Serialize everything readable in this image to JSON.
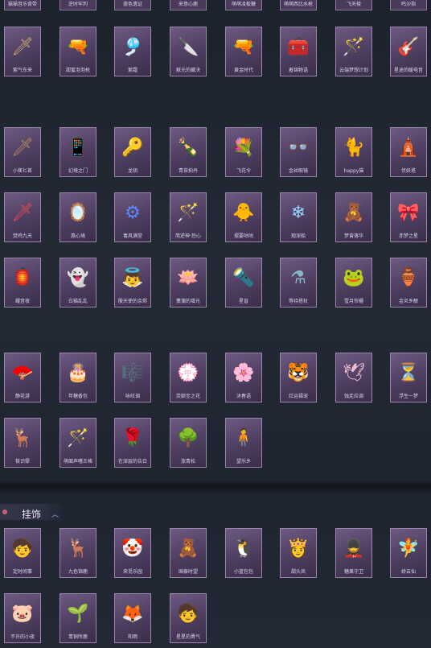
{
  "top_row": [
    "猫猫音乐背带",
    "逆时牢判",
    "鎏色遗证",
    "来意心鹿",
    "萌萌凌板鞭",
    "萌萌西比水枪",
    "飞天棱",
    "鸣沙指"
  ],
  "grid_a": [
    [
      {
        "label": "紫气东来",
        "icon": "sword-icon",
        "glyph": "🗡",
        "color": "#c7a46a"
      },
      {
        "label": "甜蜜泡泡枪",
        "icon": "bubble-gun-icon",
        "glyph": "🔫",
        "color": "#f2a8d0"
      },
      {
        "label": "絮霜",
        "icon": "flute-icon",
        "glyph": "🎐",
        "color": "#e6e6e6"
      },
      {
        "label": "献光的藏决",
        "icon": "blade-icon",
        "glyph": "🔪",
        "color": "#8ea3c8"
      },
      {
        "label": "黄金时代",
        "icon": "revolver-icon",
        "glyph": "🔫",
        "color": "#d2a04a"
      },
      {
        "label": "着锦物语",
        "icon": "medkit-icon",
        "glyph": "🧰",
        "color": "#d24a5a"
      },
      {
        "label": "云端梦想计划",
        "icon": "wand-icon",
        "glyph": "🪄",
        "color": "#7ec0ff"
      },
      {
        "label": "星途的暖电音",
        "icon": "guitar-icon",
        "glyph": "🎸",
        "color": "#b48ae6"
      }
    ],
    [
      {
        "label": "小崔匕首",
        "icon": "dagger-icon",
        "glyph": "🗡",
        "color": "#b08a5a"
      },
      {
        "label": "幻境之门",
        "icon": "phone-icon",
        "glyph": "📱",
        "color": "#a0b8ff"
      },
      {
        "label": "龙钥",
        "icon": "key-icon",
        "glyph": "🔑",
        "color": "#e6c45a"
      },
      {
        "label": "青苔拍丹",
        "icon": "bottle-icon",
        "glyph": "🍾",
        "color": "#8fd1a0"
      },
      {
        "label": "飞花令",
        "icon": "bouquet-icon",
        "glyph": "💐",
        "color": "#e66a8a"
      },
      {
        "label": "金丝眼镜",
        "icon": "glasses-icon",
        "glyph": "👓",
        "color": "#c8c8c8"
      },
      {
        "label": "happy猫",
        "icon": "cat-icon",
        "glyph": "🐈",
        "color": "#e6b47a"
      },
      {
        "label": "伏妖塔",
        "icon": "pagoda-icon",
        "glyph": "🛕",
        "color": "#d7c07a"
      }
    ],
    [
      {
        "label": "焚鸡九天",
        "icon": "spear-icon",
        "glyph": "🗡",
        "color": "#e64a4a"
      },
      {
        "label": "惠心境",
        "icon": "mirror-icon",
        "glyph": "🪞",
        "color": "#d8b07a"
      },
      {
        "label": "毒风满堂",
        "icon": "gear-icon",
        "glyph": "⚙",
        "color": "#5a8aff"
      },
      {
        "label": "简逆神·恕心",
        "icon": "scepter-icon",
        "glyph": "🪄",
        "color": "#e65a6a"
      },
      {
        "label": "摆要咕咕",
        "icon": "chick-icon",
        "glyph": "🐥",
        "color": "#f2d24a"
      },
      {
        "label": "观深船",
        "icon": "snowflake-icon",
        "glyph": "❄",
        "color": "#9ad6ff"
      },
      {
        "label": "梦曾落华",
        "icon": "doll-icon",
        "glyph": "🧸",
        "color": "#f0a0b8"
      },
      {
        "label": "赤梦之星",
        "icon": "star-hat-icon",
        "glyph": "🎀",
        "color": "#f49ac8"
      }
    ],
    [
      {
        "label": "耀音夜",
        "icon": "lantern-icon",
        "glyph": "🏮",
        "color": "#d8c07a"
      },
      {
        "label": "白猫乱乱",
        "icon": "ghost-icon",
        "glyph": "👻",
        "color": "#b8d8ff"
      },
      {
        "label": "殷天使的余烬",
        "icon": "angel-doll-icon",
        "glyph": "👼",
        "color": "#f0d0c0"
      },
      {
        "label": "薰蒲的增光",
        "icon": "lotus-icon",
        "glyph": "🪷",
        "color": "#f2a06a"
      },
      {
        "label": "星盲",
        "icon": "rod-icon",
        "glyph": "🔦",
        "color": "#7a8cff"
      },
      {
        "label": "等待搭杖",
        "icon": "cauldron-icon",
        "glyph": "⚗",
        "color": "#8ab8c8"
      },
      {
        "label": "雪月帘櫃",
        "icon": "frog-icon",
        "glyph": "🐸",
        "color": "#8ac07a"
      },
      {
        "label": "金炎乡酿",
        "icon": "jar-icon",
        "glyph": "🏺",
        "color": "#7a9a6a"
      }
    ]
  ],
  "grid_b": [
    [
      {
        "label": "静花游",
        "icon": "fan-icon",
        "glyph": "🪭",
        "color": "#a8e0d0"
      },
      {
        "label": "年糖香包",
        "icon": "cake-icon",
        "glyph": "🎂",
        "color": "#f0b0c8"
      },
      {
        "label": "咏叹调",
        "icon": "harp-icon",
        "glyph": "🎼",
        "color": "#c8b08a"
      },
      {
        "label": "荧娘至之花",
        "icon": "wreath-icon",
        "glyph": "💮",
        "color": "#f2d0e0"
      },
      {
        "label": "沐春语",
        "icon": "branch-icon",
        "glyph": "🌸",
        "color": "#e6e6b0"
      },
      {
        "label": "红运福宠",
        "icon": "cat-toy-icon",
        "glyph": "🐯",
        "color": "#f2c04a"
      },
      {
        "label": "蚀走应调",
        "icon": "bird-icon",
        "glyph": "🕊",
        "color": "#f0c0d0"
      },
      {
        "label": "浮生一梦",
        "icon": "hourglass-icon",
        "glyph": "⏳",
        "color": "#d8c890"
      }
    ],
    [
      {
        "label": "筱识霏",
        "icon": "antler-icon",
        "glyph": "🦌",
        "color": "#d8b07a"
      },
      {
        "label": "萌面声嗜王格",
        "icon": "staff-icon",
        "glyph": "🪄",
        "color": "#e65a3a"
      },
      {
        "label": "在深层的告白",
        "icon": "rose-icon",
        "glyph": "🌹",
        "color": "#e64a5a"
      },
      {
        "label": "旅青松",
        "icon": "bonsai-icon",
        "glyph": "🌳",
        "color": "#6ac07a"
      },
      {
        "label": "望乐乡",
        "icon": "figure-icon",
        "glyph": "🧍",
        "color": "#3a3a4a"
      }
    ]
  ],
  "section": {
    "title": "挂饰"
  },
  "grid_c": [
    [
      {
        "label": "定时闹事",
        "icon": "boy-charm-icon",
        "glyph": "🧒",
        "color": "#e0c8b0"
      },
      {
        "label": "九色锦鹿",
        "icon": "deer-charm-icon",
        "glyph": "🦌",
        "color": "#f0f0f0"
      },
      {
        "label": "来觅乐园",
        "icon": "clown-charm-icon",
        "glyph": "🤡",
        "color": "#c88ae6"
      },
      {
        "label": "国泰时望",
        "icon": "bear-charm-icon",
        "glyph": "🧸",
        "color": "#9ab0e6"
      },
      {
        "label": "小蓝包包",
        "icon": "penguin-charm-icon",
        "glyph": "🐧",
        "color": "#8ac8f2"
      },
      {
        "label": "甜头凤",
        "icon": "girl-charm-icon",
        "glyph": "👸",
        "color": "#f2c06a"
      },
      {
        "label": "糖果守卫",
        "icon": "soldier-charm-icon",
        "glyph": "💂",
        "color": "#e66a3a"
      },
      {
        "label": "娇云仙",
        "icon": "fairy-charm-icon",
        "glyph": "🧚",
        "color": "#f0b0d0"
      }
    ],
    [
      {
        "label": "不许的小夜",
        "icon": "pig-charm-icon",
        "glyph": "🐷",
        "color": "#f2a0b8"
      },
      {
        "label": "青铜所鹿",
        "icon": "seed-charm-icon",
        "glyph": "🌱",
        "color": "#a0d07a"
      },
      {
        "label": "和雨",
        "icon": "fox-charm-icon",
        "glyph": "🦊",
        "color": "#e6a0c0"
      },
      {
        "label": "星星的勇气",
        "icon": "kid-charm-icon",
        "glyph": "🧒",
        "color": "#f2d06a"
      }
    ]
  ]
}
